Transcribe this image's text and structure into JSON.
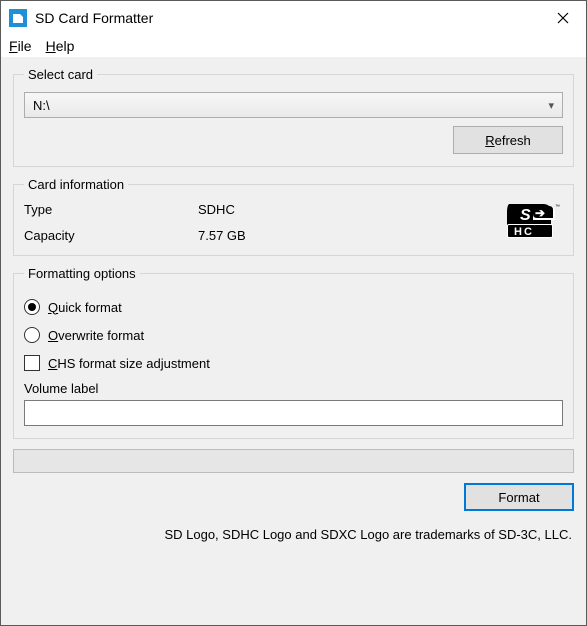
{
  "window": {
    "title": "SD Card Formatter"
  },
  "menu": {
    "file": "File",
    "help": "Help"
  },
  "select_card": {
    "legend": "Select card",
    "selected_drive": "N:\\",
    "refresh_label": "Refresh"
  },
  "card_info": {
    "legend": "Card information",
    "type_label": "Type",
    "type_value": "SDHC",
    "capacity_label": "Capacity",
    "capacity_value": "7.57 GB"
  },
  "formatting": {
    "legend": "Formatting options",
    "quick_label": "Quick format",
    "overwrite_label": "Overwrite format",
    "chs_label": "CHS format size adjustment",
    "volume_label_caption": "Volume label",
    "volume_label_value": ""
  },
  "actions": {
    "format_label": "Format"
  },
  "footer": {
    "trademark": "SD Logo, SDHC Logo and SDXC Logo are trademarks of SD-3C, LLC."
  }
}
